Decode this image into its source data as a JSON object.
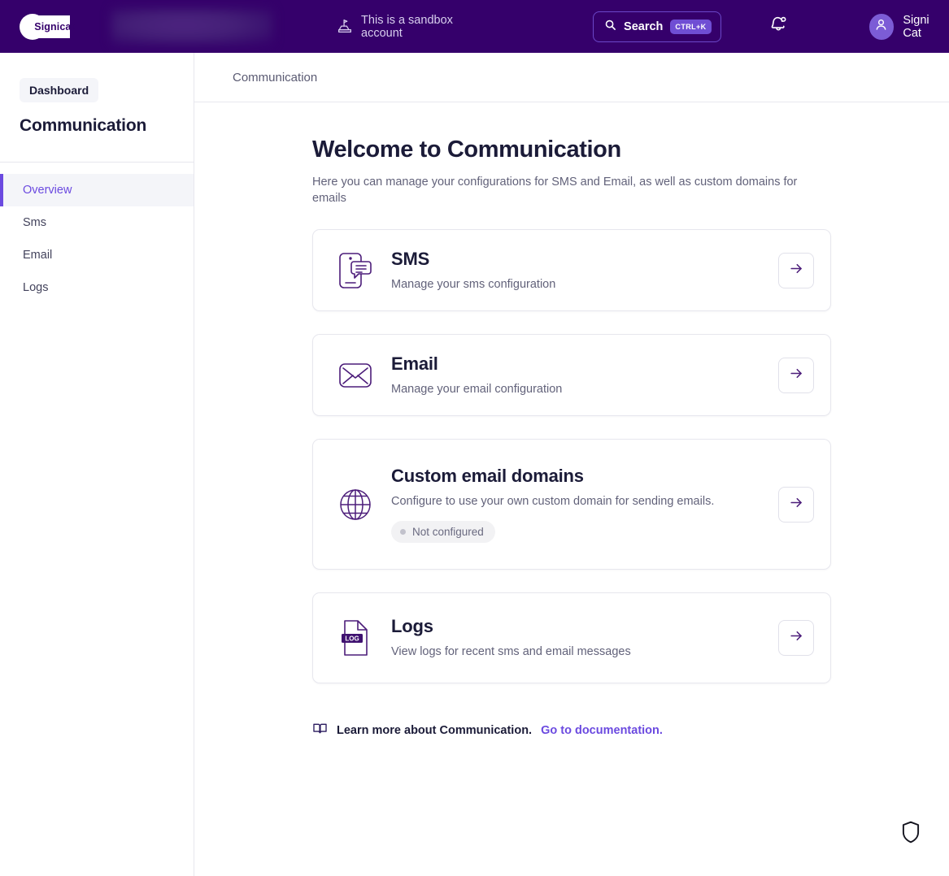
{
  "topbar": {
    "brand": "Signicat",
    "account_redacted": "",
    "sandbox_notice": "This is a sandbox account",
    "sandbox_icon": "sandbox-flag-icon",
    "search_label": "Search",
    "search_shortcut": "CTRL+K",
    "search_icon": "search-icon",
    "bell_icon": "notification-bell-icon",
    "user_name": "Signi Cat",
    "avatar_icon": "user-avatar-icon",
    "background_color": "#35006b",
    "accent_color": "#6f4ed4"
  },
  "sidebar": {
    "dashboard_label": "Dashboard",
    "section_title": "Communication",
    "items": [
      {
        "label": "Overview",
        "active": true
      },
      {
        "label": "Sms",
        "active": false
      },
      {
        "label": "Email",
        "active": false
      },
      {
        "label": "Logs",
        "active": false
      }
    ],
    "active_color": "#6b4ae0"
  },
  "main": {
    "breadcrumb": "Communication",
    "title": "Welcome to Communication",
    "subtitle": "Here you can manage your configurations for SMS and Email, as well as custom domains for emails",
    "cards": [
      {
        "icon": "sms-phone-chat-icon",
        "title": "SMS",
        "description": "Manage your sms configuration",
        "arrow_icon": "arrow-right-icon"
      },
      {
        "icon": "email-envelope-icon",
        "title": "Email",
        "description": "Manage your email configuration",
        "arrow_icon": "arrow-right-icon"
      },
      {
        "icon": "globe-icon",
        "title": "Custom email domains",
        "description": "Configure to use your own custom domain for sending emails.",
        "status": "Not configured",
        "arrow_icon": "arrow-right-icon"
      },
      {
        "icon": "log-document-icon",
        "title": "Logs",
        "description": "View logs for recent sms and email messages",
        "badge_text": "LOG",
        "arrow_icon": "arrow-right-icon"
      }
    ],
    "learn_more_icon": "book-icon",
    "learn_more_text": "Learn more about Communication.",
    "learn_more_link": "Go to documentation."
  },
  "widget": {
    "shield_icon": "shield-icon"
  }
}
